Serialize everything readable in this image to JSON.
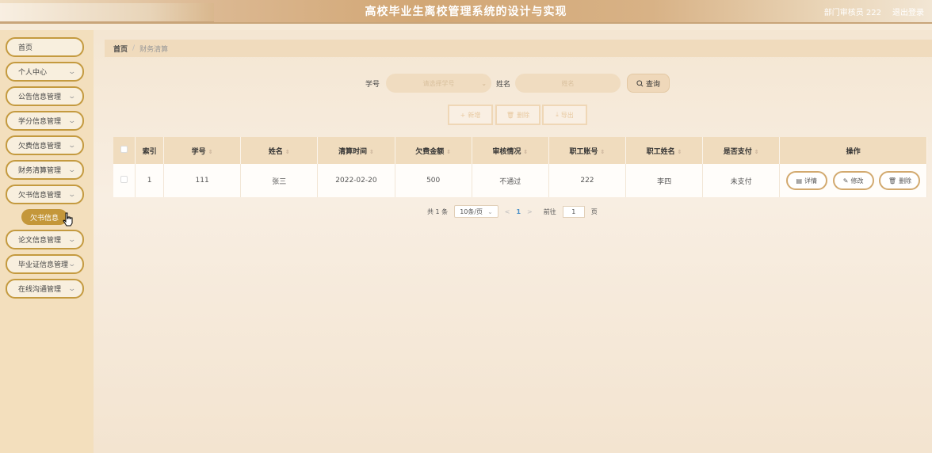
{
  "header": {
    "title": "高校毕业生离校管理系统的设计与实现",
    "user_label": "部门审核员 222",
    "logout_label": "退出登录"
  },
  "sidebar": {
    "items": [
      {
        "label": "首页",
        "has_children": false
      },
      {
        "label": "个人中心",
        "has_children": true
      },
      {
        "label": "公告信息管理",
        "has_children": true
      },
      {
        "label": "学分信息管理",
        "has_children": true
      },
      {
        "label": "欠费信息管理",
        "has_children": true
      },
      {
        "label": "财务清算管理",
        "has_children": true
      },
      {
        "label": "欠书信息管理",
        "has_children": true
      },
      {
        "label": "论文信息管理",
        "has_children": true
      },
      {
        "label": "毕业证信息管理",
        "has_children": true
      },
      {
        "label": "在线沟通管理",
        "has_children": true
      }
    ],
    "active_sub_item": "欠书信息"
  },
  "breadcrumb": {
    "home": "首页",
    "separator": "/",
    "current": "财务清算"
  },
  "search": {
    "student_id_label": "学号",
    "student_id_placeholder": "请选择学号",
    "name_label": "姓名",
    "name_placeholder": "姓名",
    "query_label": "查询"
  },
  "toolbar": {
    "add_label": "新增",
    "delete_label": "删除",
    "export_label": "导出"
  },
  "table": {
    "columns": [
      "索引",
      "学号",
      "姓名",
      "清算时间",
      "欠费金额",
      "审核情况",
      "职工账号",
      "职工姓名",
      "是否支付",
      "操作"
    ],
    "rows": [
      {
        "index": "1",
        "student_id": "111",
        "name": "张三",
        "settle_time": "2022-02-20",
        "amount": "500",
        "review": "不通过",
        "staff_account": "222",
        "staff_name": "李四",
        "paid": "未支付"
      }
    ],
    "actions": {
      "detail": "详情",
      "edit": "修改",
      "delete": "删除"
    }
  },
  "pagination": {
    "total_text": "共 1 条",
    "page_size": "10条/页",
    "current_page": "1",
    "goto_label": "前往",
    "goto_value": "1",
    "page_unit": "页"
  },
  "colors": {
    "accent": "#c4973a",
    "header_bg": "#d2a775",
    "table_header": "#f0dcbe"
  }
}
